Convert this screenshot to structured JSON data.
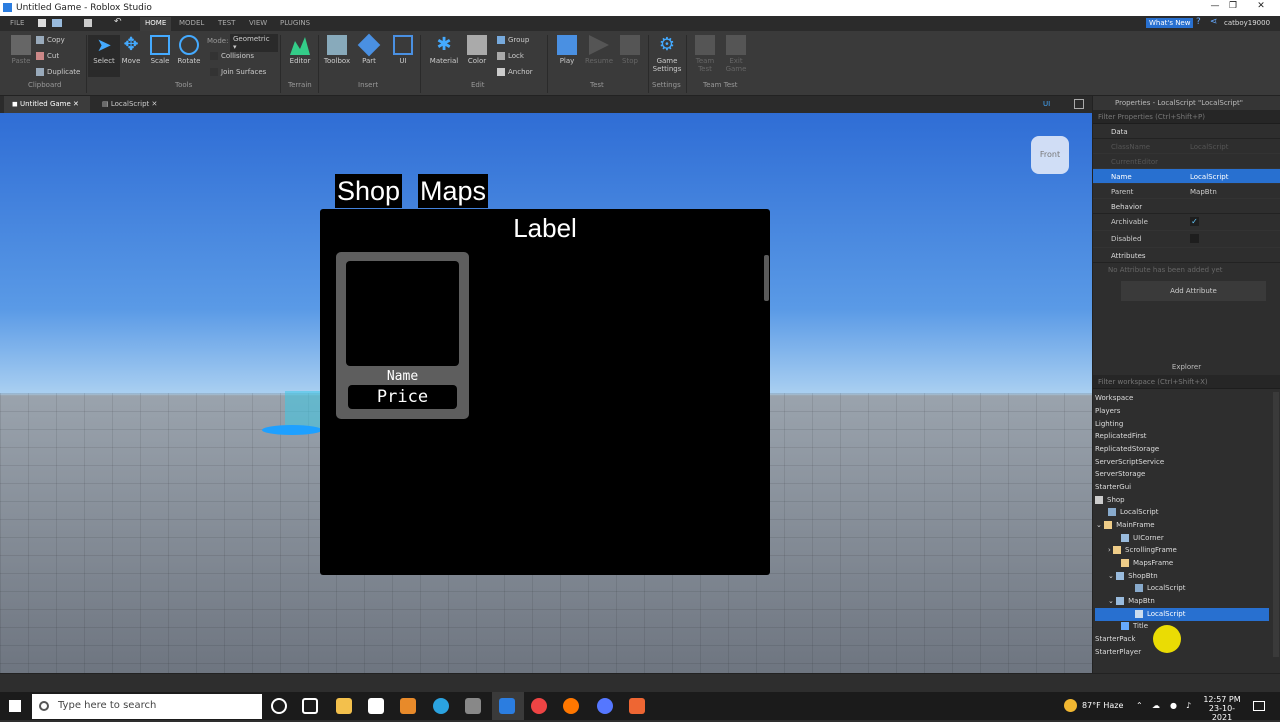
{
  "window": {
    "title": "Untitled Game - Roblox Studio"
  },
  "ribbon_tabs": {
    "file": "FILE",
    "home": "HOME",
    "model": "MODEL",
    "test": "TEST",
    "view": "VIEW",
    "plugins": "PLUGINS"
  },
  "ribbon": {
    "clipboard": {
      "paste": "Paste",
      "copy": "Copy",
      "cut": "Cut",
      "duplicate": "Duplicate",
      "group": "Clipboard"
    },
    "tools": {
      "select": "Select",
      "move": "Move",
      "scale": "Scale",
      "rotate": "Rotate",
      "mode_label": "Mode:",
      "mode_value": "Geometric",
      "collisions": "Collisions",
      "join_surfaces": "Join Surfaces",
      "group": "Tools"
    },
    "terrain": {
      "editor": "Editor",
      "group": "Terrain"
    },
    "insert": {
      "toolbox": "Toolbox",
      "part": "Part",
      "ui": "UI",
      "group": "Insert"
    },
    "edit": {
      "material": "Material",
      "color": "Color",
      "group_btn": "Group",
      "lock": "Lock",
      "anchor": "Anchor",
      "group": "Edit"
    },
    "test": {
      "play": "Play",
      "resume": "Resume",
      "stop": "Stop",
      "group": "Test"
    },
    "settings": {
      "game_settings_1": "Game",
      "game_settings_2": "Settings",
      "group": "Settings"
    },
    "team_test": {
      "team_test_1": "Team",
      "team_test_2": "Test",
      "exit_game_1": "Exit",
      "exit_game_2": "Game",
      "group": "Team Test"
    }
  },
  "topright": {
    "whats_new": "What's New",
    "user": "catboy19000"
  },
  "doc_tabs": {
    "game": "Untitled Game",
    "script": "LocalScript",
    "ui_toggle": "UI"
  },
  "viewport": {
    "view_cube": "Front",
    "frame_title": "Label",
    "shop_btn": "Shop",
    "maps_btn": "Maps",
    "card_name": "Name",
    "card_price": "Price"
  },
  "properties": {
    "header": "Properties - LocalScript \"LocalScript\"",
    "filter_placeholder": "Filter Properties (Ctrl+Shift+P)",
    "sections": {
      "data": "Data",
      "behavior": "Behavior",
      "attributes": "Attributes"
    },
    "rows": [
      {
        "key": "ClassName",
        "value": "LocalScript"
      },
      {
        "key": "CurrentEditor",
        "value": ""
      },
      {
        "key": "Name",
        "value": "LocalScript"
      },
      {
        "key": "Parent",
        "value": "MapBtn"
      },
      {
        "key": "Archivable",
        "value": "✓"
      },
      {
        "key": "Disabled",
        "value": ""
      }
    ],
    "no_attributes": "No Attribute has been added yet",
    "add_attribute": "Add Attribute"
  },
  "explorer": {
    "header": "Explorer",
    "filter_placeholder": "Filter workspace (Ctrl+Shift+X)",
    "items": [
      {
        "label": "Workspace"
      },
      {
        "label": "Players"
      },
      {
        "label": "Lighting"
      },
      {
        "label": "ReplicatedFirst"
      },
      {
        "label": "ReplicatedStorage"
      },
      {
        "label": "ServerScriptService"
      },
      {
        "label": "ServerStorage"
      },
      {
        "label": "StarterGui"
      },
      {
        "label": "Shop"
      },
      {
        "label": "LocalScript"
      },
      {
        "label": "MainFrame"
      },
      {
        "label": "UICorner"
      },
      {
        "label": "ScrollingFrame"
      },
      {
        "label": "MapsFrame"
      },
      {
        "label": "ShopBtn"
      },
      {
        "label": "LocalScript"
      },
      {
        "label": "MapBtn"
      },
      {
        "label": "LocalScript"
      },
      {
        "label": "Title"
      },
      {
        "label": "StarterPack"
      },
      {
        "label": "StarterPlayer"
      }
    ]
  },
  "taskbar": {
    "search_placeholder": "Type here to search",
    "weather": "87°F  Haze",
    "time": "12:57 PM",
    "date": "23-10-2021"
  },
  "colors": {
    "accent": "#2870d0",
    "viewport_sky": "#5a9ae6"
  }
}
